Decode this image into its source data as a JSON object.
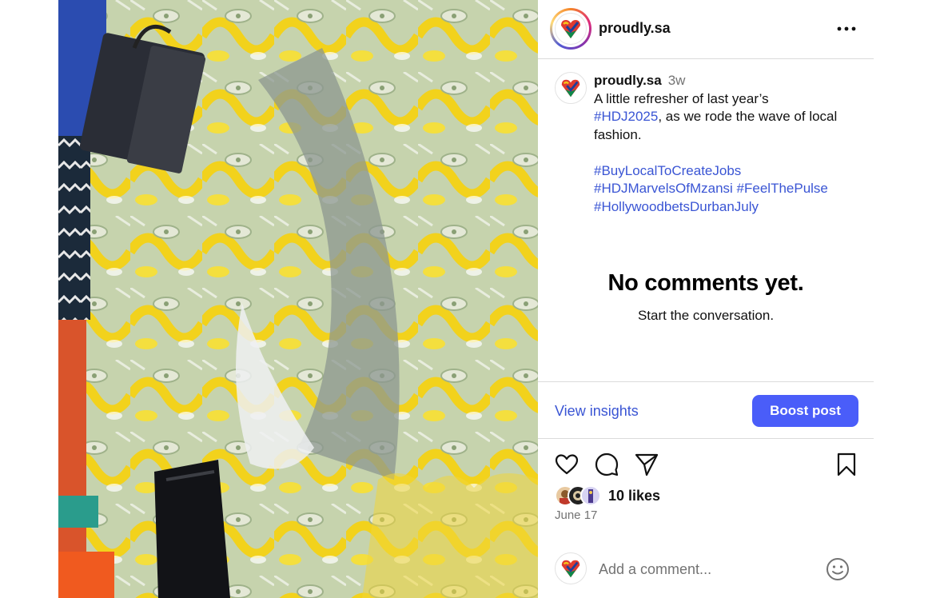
{
  "post": {
    "username": "proudly.sa",
    "time_ago": "3w",
    "caption_line1": "A little refresher of last year’s",
    "caption_tag1": "#HDJ2025",
    "caption_line2": ", as we rode the wave of local fashion.",
    "hashtags": [
      "#BuyLocalToCreateJobs",
      "#HDJMarvelsOfMzansi",
      "#FeelThePulse",
      "#HollywoodbetsDurbanJuly"
    ]
  },
  "comments": {
    "empty_title": "No comments yet.",
    "empty_subtitle": "Start the conversation."
  },
  "insights": {
    "view_label": "View insights",
    "boost_label": "Boost post"
  },
  "engagement": {
    "likes": "10 likes",
    "date": "June 17"
  },
  "comment_box": {
    "placeholder": "Add a comment..."
  },
  "icons": {
    "more": "more-horizontal-icon",
    "like": "heart-icon",
    "comment": "comment-icon",
    "share": "send-icon",
    "save": "bookmark-icon",
    "emoji": "emoji-icon"
  },
  "colors": {
    "link": "#3a55d4",
    "boost_button": "#4a5df9",
    "muted_text": "#737373",
    "divider": "#dbdbdb"
  }
}
